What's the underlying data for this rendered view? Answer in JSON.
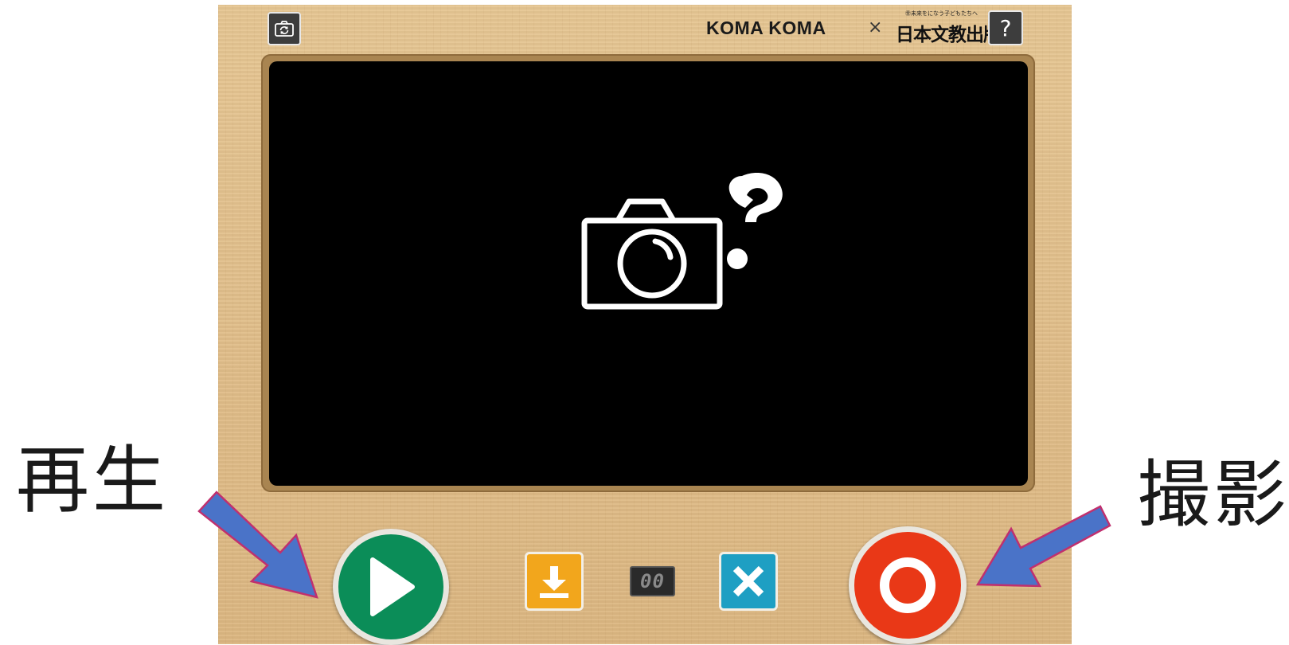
{
  "app": {
    "brand_name": "KOMA KOMA",
    "brand_separator": "×",
    "publisher_tagline": "㊎未来をになう子どもたちへ",
    "publisher": "日本文教出版",
    "help_label": "?",
    "frame_count": "00"
  },
  "annotations": {
    "play_label": "再生",
    "record_label": "撮影"
  },
  "icons": {
    "camera_switch": "camera-rotate-icon",
    "viewer_placeholder": "camera-question-icon",
    "play": "play-triangle-icon",
    "record": "record-circle-icon",
    "save": "download-arrow-icon",
    "delete": "close-x-icon"
  },
  "colors": {
    "board": "#e2c08e",
    "play": "#0b8d58",
    "record": "#e93817",
    "save": "#f2a61c",
    "delete": "#1e9fc3",
    "arrow": "#4a73c8",
    "arrow_outline": "#c0306e"
  }
}
